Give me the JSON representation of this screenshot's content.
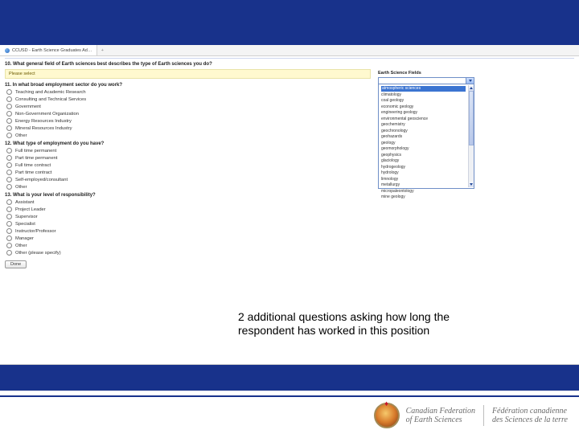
{
  "tab": {
    "title": "CCUSD - Earth Science Graduates Ad…"
  },
  "q10": {
    "title": "10. What general field of Earth sciences best describes the type of Earth sciences you do?",
    "alert": "Please select",
    "field_label": "Earth Science Fields",
    "options": [
      "atmospheric sciences",
      "climatology",
      "coal geology",
      "economic geology",
      "engineering geology",
      "environmental geoscience",
      "geochemistry",
      "geochronology",
      "geohazards",
      "geology",
      "geomorphology",
      "geophysics",
      "glaciology",
      "hydrogeology",
      "hydrology",
      "limnology",
      "metallurgy",
      "micropaleontology",
      "mine geology"
    ]
  },
  "q11": {
    "title": "11. In what broad employment sector do you work?",
    "options": [
      "Teaching and Academic Research",
      "Consulting and Technical Services",
      "Government",
      "Non-Government Organization",
      "Energy Resources Industry",
      "Mineral Resources Industry",
      "Other"
    ]
  },
  "q12": {
    "title": "12. What type of employment do you have?",
    "options": [
      "Full time permanent",
      "Part time permanent",
      "Full time contract",
      "Part time contract",
      "Self-employed/consultant",
      "Other"
    ]
  },
  "q13": {
    "title": "13. What is your level of responsibility?",
    "options": [
      "Assistant",
      "Project Leader",
      "Supervisor",
      "Specialist",
      "Instructor/Professor",
      "Manager",
      "Other",
      "Other (please specify)"
    ]
  },
  "callout": "2 additional questions asking how long the respondent has worked in this position",
  "done": "Done",
  "footer": {
    "en1": "Canadian Federation",
    "en2": "of Earth Sciences",
    "fr1": "Fédération canadienne",
    "fr2": "des Sciences de la terre",
    "leaf": "♦"
  }
}
